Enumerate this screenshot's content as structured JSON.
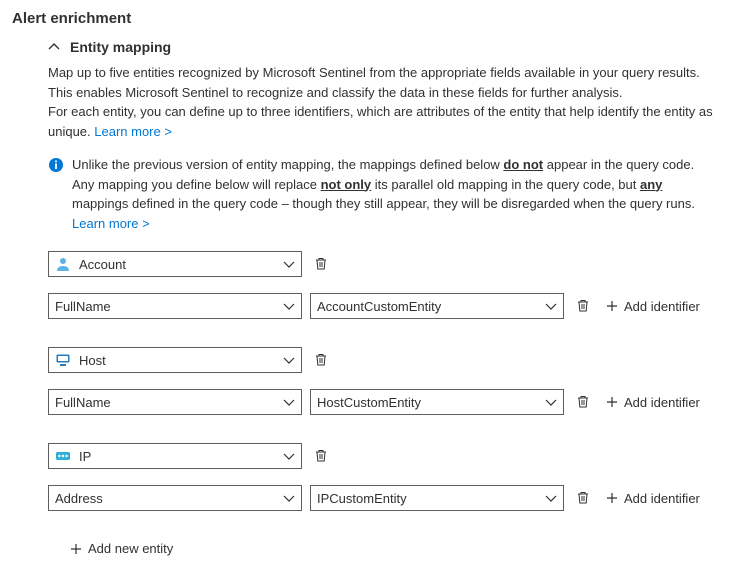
{
  "page_title": "Alert enrichment",
  "section": {
    "title": "Entity mapping",
    "desc_line1": "Map up to five entities recognized by Microsoft Sentinel from the appropriate fields available in your query results.",
    "desc_line2": "This enables Microsoft Sentinel to recognize and classify the data in these fields for further analysis.",
    "desc_line3_a": "For each entity, you can define up to three identifiers, which are attributes of the entity that help identify the entity as unique. ",
    "learn_more": "Learn more >",
    "info_a": "Unlike the previous version of entity mapping, the mappings defined below ",
    "info_b": "do not",
    "info_c": " appear in the query code. Any mapping you define below will replace ",
    "info_d": "not only",
    "info_e": " its parallel old mapping in the query code, but ",
    "info_f": "any",
    "info_g": " mappings defined in the query code – though they still appear, they will be disregarded when the query runs. "
  },
  "entities": [
    {
      "type": "Account",
      "identifier": "FullName",
      "value": "AccountCustomEntity"
    },
    {
      "type": "Host",
      "identifier": "FullName",
      "value": "HostCustomEntity"
    },
    {
      "type": "IP",
      "identifier": "Address",
      "value": "IPCustomEntity"
    }
  ],
  "labels": {
    "add_identifier": "Add identifier",
    "add_entity": "Add new entity"
  }
}
